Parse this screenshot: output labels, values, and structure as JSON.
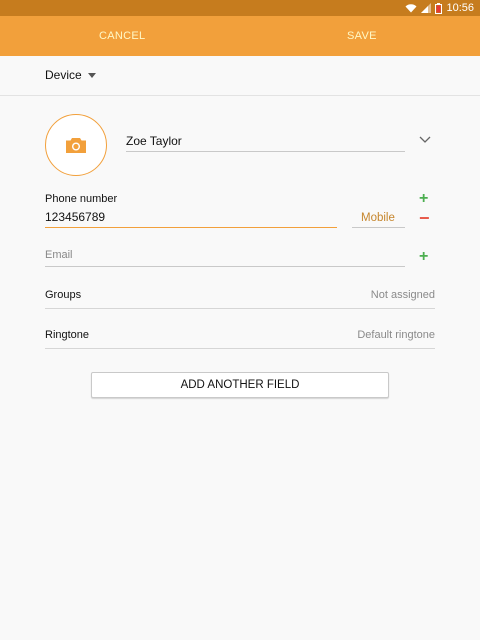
{
  "status_bar": {
    "time": "10:56"
  },
  "action_bar": {
    "cancel_label": "CANCEL",
    "save_label": "SAVE"
  },
  "storage": {
    "label": "Device"
  },
  "contact": {
    "name": "Zoe Taylor"
  },
  "phone": {
    "label": "Phone number",
    "value": "123456789",
    "type": "Mobile"
  },
  "email": {
    "placeholder": "Email"
  },
  "groups": {
    "label": "Groups",
    "value": "Not assigned"
  },
  "ringtone": {
    "label": "Ringtone",
    "value": "Default ringtone"
  },
  "add_field": {
    "label": "ADD ANOTHER FIELD"
  },
  "colors": {
    "accent": "#f2a03b",
    "status_bar": "#c67c1e",
    "add": "#4caf50",
    "remove": "#e85a4a"
  }
}
